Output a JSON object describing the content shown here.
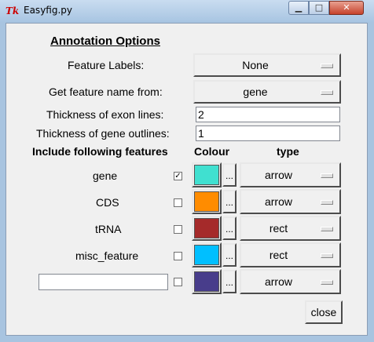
{
  "window": {
    "title": "Easyfig.py",
    "app_icon": "tk-icon"
  },
  "dialog": {
    "heading": "Annotation Options",
    "feature_labels": {
      "label": "Feature Labels:",
      "value": "None"
    },
    "feature_name": {
      "label": "Get feature name from:",
      "value": "gene"
    },
    "exon_thickness": {
      "label": "Thickness of exon lines:",
      "value": "2"
    },
    "gene_outline_thickness": {
      "label": "Thickness of gene outlines:",
      "value": "1"
    },
    "columns": {
      "include": "Include following features",
      "colour": "Colour",
      "type": "type"
    },
    "features": [
      {
        "name": "gene",
        "checked": true,
        "check_mark": "✓",
        "color": "#40e0d0",
        "type": "arrow",
        "more": "..."
      },
      {
        "name": "CDS",
        "checked": false,
        "check_mark": "",
        "color": "#ff8c00",
        "type": "arrow",
        "more": "..."
      },
      {
        "name": "tRNA",
        "checked": false,
        "check_mark": "",
        "color": "#a52a2a",
        "type": "rect",
        "more": "..."
      },
      {
        "name": "misc_feature",
        "checked": false,
        "check_mark": "",
        "color": "#00bfff",
        "type": "rect",
        "more": "..."
      },
      {
        "name": "",
        "checked": false,
        "check_mark": "",
        "color": "#483d8b",
        "type": "arrow",
        "more": "..."
      }
    ],
    "close_label": "close"
  }
}
